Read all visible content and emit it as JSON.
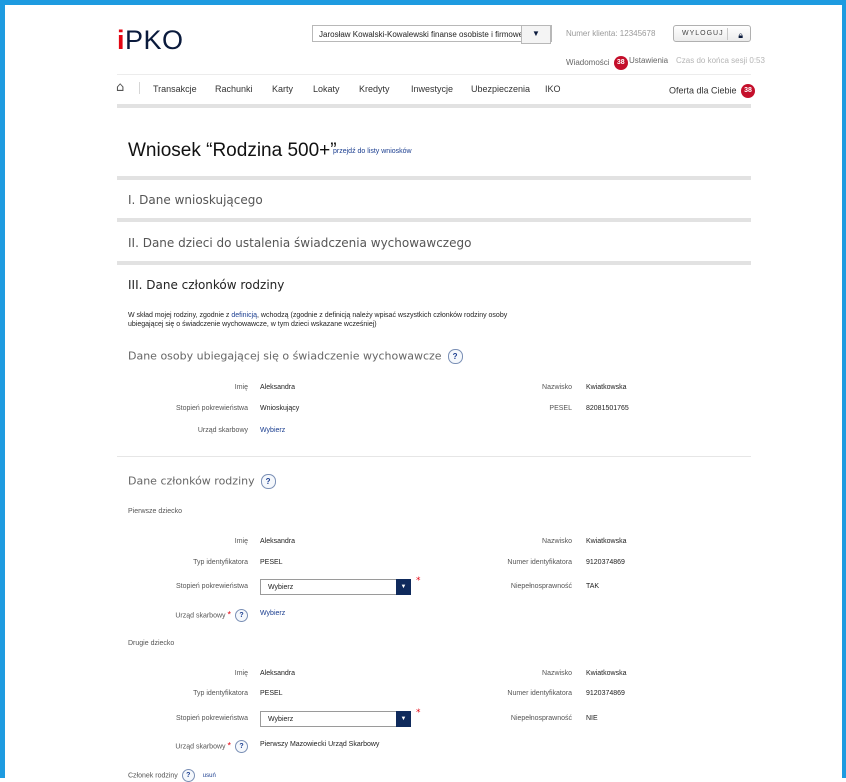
{
  "header": {
    "logo": "PKO",
    "user_select": "Jarosław Kowalski-Kowalewski finanse osobiste i firmowe",
    "client_number": "Numer klienta: 12345678",
    "logout_label": "WYLOGUJ",
    "messages_label": "Wiadomości",
    "messages_count": "38",
    "settings_label": "Ustawienia",
    "session_label": "Czas do końca sesji 0:53"
  },
  "nav": {
    "items": [
      "Transakcje",
      "Rachunki",
      "Karty",
      "Lokaty",
      "Kredyty",
      "Inwestycje",
      "Ubezpieczenia",
      "IKO"
    ],
    "offer_label": "Oferta dla Ciebie",
    "offer_count": "38"
  },
  "page": {
    "title": "Wniosek “Rodzina 500+”",
    "title_link": "przejdź do listy wniosków"
  },
  "sections": {
    "s1": "I. Dane wnioskującego",
    "s2": "II. Dane dzieci do ustalenia świadczenia wychowawczego",
    "s3": "III. Dane członków rodziny"
  },
  "intro": {
    "part1": "W skład mojej rodziny, zgodnie z ",
    "link": "definicją",
    "part2": ", wchodzą (zgodnie z definicją należy wpisać wszystkich członków rodziny osoby",
    "line2": "ubiegającej się o świadczenie wychowawcze, w tym dzieci wskazane wcześniej)"
  },
  "applicant": {
    "title": "Dane osoby ubiegającej się o świadczenie wychowawcze",
    "first_name_label": "Imię",
    "first_name": "Aleksandra",
    "last_name_label": "Nazwisko",
    "last_name": "Kwiatkowska",
    "relation_label": "Stopień pokrewieństwa",
    "relation": "Wnioskujący",
    "pesel_label": "PESEL",
    "pesel": "82081501765",
    "tax_office_label": "Urząd skarbowy",
    "tax_office_link": "Wybierz"
  },
  "members": {
    "title": "Dane członków rodziny",
    "child1": {
      "title": "Pierwsze dziecko",
      "first_name_label": "Imię",
      "first_name": "Aleksandra",
      "last_name_label": "Nazwisko",
      "last_name": "Kwiatkowska",
      "id_type_label": "Typ identyfikatora",
      "id_type": "PESEL",
      "id_number_label": "Numer identyfikatora",
      "id_number": "9120374869",
      "relation_label": "Stopień pokrewieństwa",
      "relation_select": "Wybierz",
      "disability_label": "Niepełnosprawność",
      "disability": "TAK",
      "tax_office_label": "Urząd skarbowy",
      "tax_office": "Wybierz"
    },
    "child2": {
      "title": "Drugie dziecko",
      "first_name_label": "Imię",
      "first_name": "Aleksandra",
      "last_name_label": "Nazwisko",
      "last_name": "Kwiatkowska",
      "id_type_label": "Typ identyfikatora",
      "id_type": "PESEL",
      "id_number_label": "Numer identyfikatora",
      "id_number": "9120374869",
      "relation_label": "Stopień pokrewieństwa",
      "relation_select": "Wybierz",
      "disability_label": "Niepełnosprawność",
      "disability": "NIE",
      "tax_office_label": "Urząd skarbowy",
      "tax_office": "Pierwszy Mazowiecki Urząd Skarbowy"
    },
    "member3": {
      "title": "Członek rodziny",
      "remove_link": "usuń"
    }
  },
  "icons": {
    "home": "home-icon",
    "lock": "lock-icon",
    "help": "help-icon",
    "dropdown": "chevron-down-icon"
  },
  "colors": {
    "frame": "#1e9be0",
    "brand_navy": "#0a1a3c",
    "badge_red": "#c40f2b",
    "link_blue": "#1a3d8f",
    "required_red": "#e30613"
  }
}
